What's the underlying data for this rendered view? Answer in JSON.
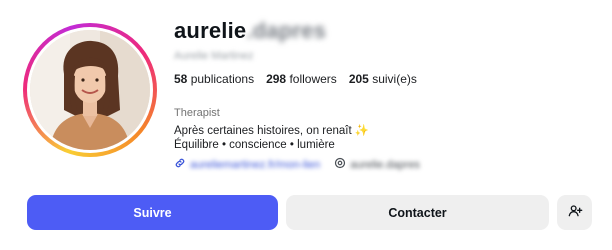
{
  "profile": {
    "username_visible": "aurelie",
    "username_blurred": ".dapres",
    "display_name": "Aurelie Martinez",
    "profession": "Therapist",
    "bio_line1": "Après certaines histoires, on renaît",
    "bio_sparkle": "✨",
    "bio_line2": "Équilibre • conscience • lumière",
    "website_link": "aureliemartinez.fr/mon-lien",
    "threads_handle": "aurelie.dapres"
  },
  "stats": {
    "posts_count": "58",
    "posts_label": "publications",
    "followers_count": "298",
    "followers_label": "followers",
    "following_count": "205",
    "following_label": "suivi(e)s"
  },
  "actions": {
    "follow_label": "Suivre",
    "contact_label": "Contacter"
  },
  "icons": {
    "link": "link-icon",
    "threads": "threads-icon",
    "add_person": "add-person-icon"
  },
  "colors": {
    "follow_button": "#4d5cf5",
    "secondary_button": "#efefef",
    "link_text": "#3b55d9",
    "story_ring": "#ee2a7b"
  }
}
